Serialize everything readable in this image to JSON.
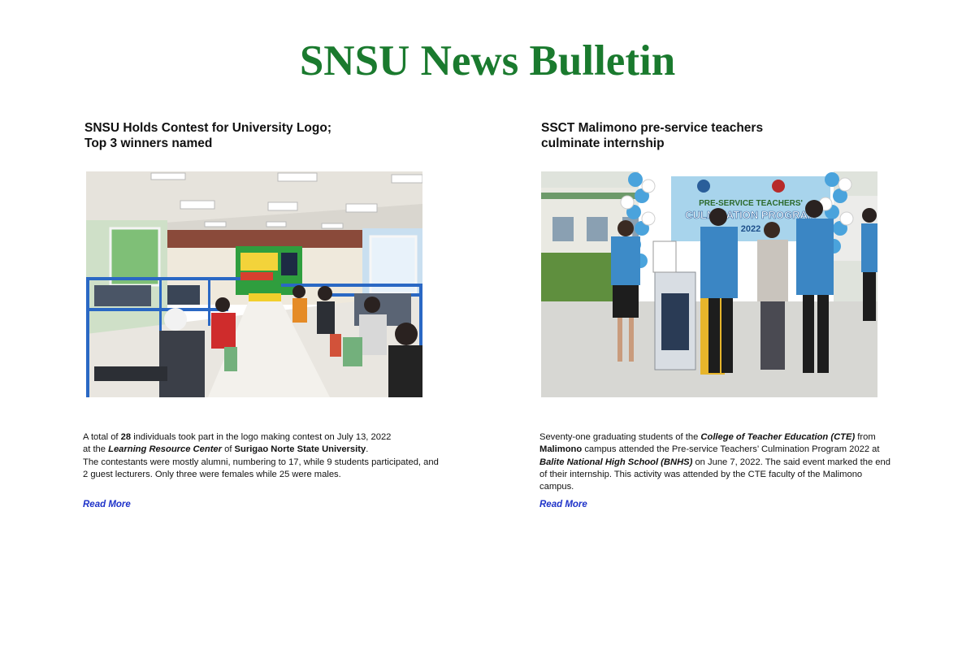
{
  "page": {
    "title": "SNSU News Bulletin",
    "accent_color": "#1a7a2e",
    "link_color": "#1f33c9"
  },
  "articles": [
    {
      "headline_line1": "SNSU Holds Contest for University Logo;",
      "headline_line2": "Top 3 winners named",
      "photo_subject": "Students at computer stations in the Learning Resource Center during the logo contest",
      "body": {
        "p1": "A total of ",
        "p1_count": "28",
        "p1b": " individuals took part in the logo making contest on July 13, 2022",
        "p2": "at the ",
        "p2_place": "Learning Resource Center",
        "p2b": " of ",
        "p2_univ": "Surigao Norte State University",
        "p2c": ".",
        "p3": "The contestants were mostly alumni, numbering to 17, while 9 students participated, and 2 guest lecturers. Only three were females while 25 were males."
      },
      "read_more": "Read More"
    },
    {
      "headline_line1": "SSCT Malimono pre-service teachers",
      "headline_line2": "culminate internship",
      "photo_subject": "Officials presenting a certificate on stage at the Pre-service Teachers Culmination Program 2022",
      "banner_text_1": "PRE-SERVICE TEACHERS'",
      "banner_text_2": "CULMINATION PROGRAM",
      "banner_text_3": "2022",
      "body": {
        "s1": "Seventy-one graduating students of the ",
        "s1_college": "College of Teacher Education (CTE)",
        "s1b": " from ",
        "s1_campus": "Malimono",
        "s1c": " campus attended the Pre-service Teachers’ Culmination Program 2022 at ",
        "s1_school": "Balite National High School (BNHS)",
        "s1d": " on June 7, 2022. The said event marked the end of their internship. This activity was attended by the CTE faculty of the Malimono campus."
      },
      "read_more": "Read More"
    }
  ]
}
